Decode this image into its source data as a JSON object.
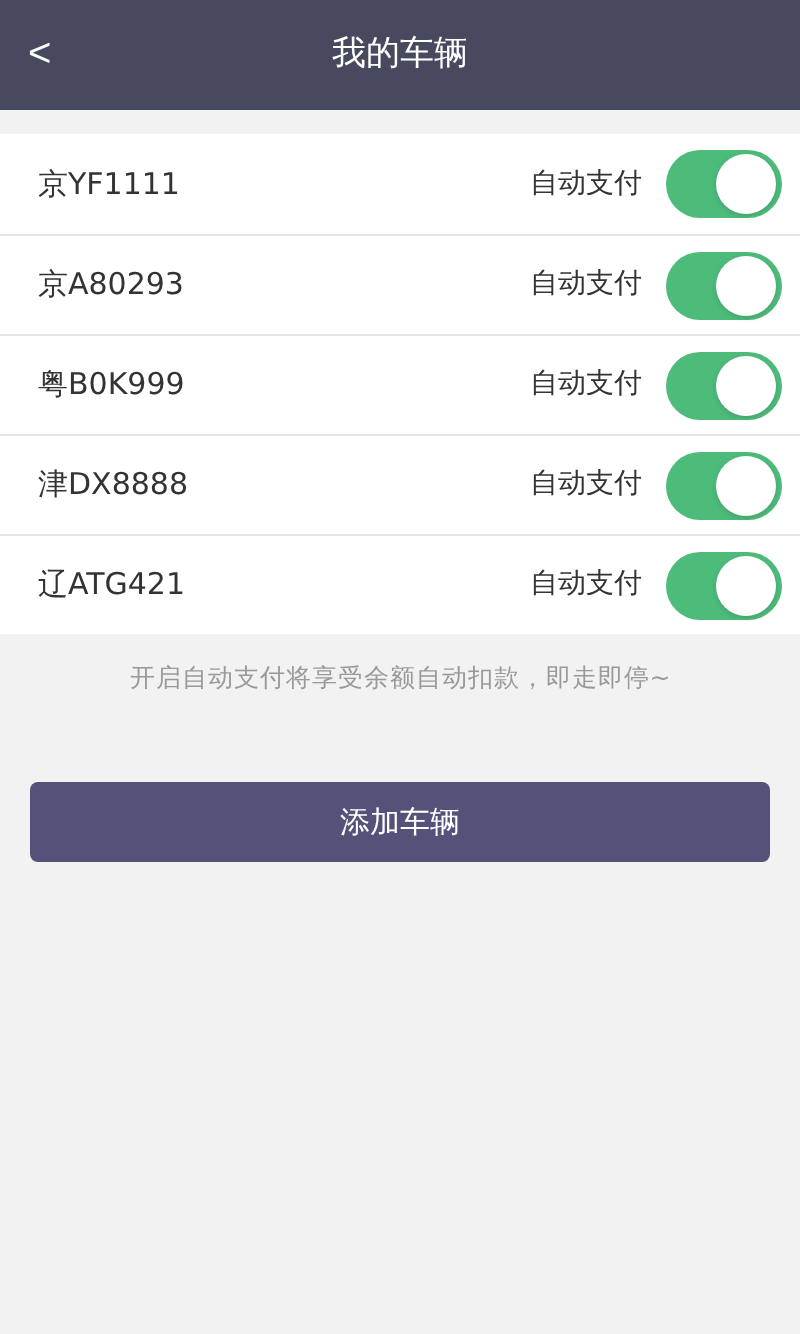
{
  "header": {
    "back_icon": "<",
    "title": "我的车辆"
  },
  "vehicles": [
    {
      "plate": "京YF1111",
      "label": "自动支付",
      "on": true
    },
    {
      "plate": "京A80293",
      "label": "自动支付",
      "on": true
    },
    {
      "plate": "粤B0K999",
      "label": "自动支付",
      "on": true
    },
    {
      "plate": "津DX8888",
      "label": "自动支付",
      "on": true
    },
    {
      "plate": "辽ATG421",
      "label": "自动支付",
      "on": true
    }
  ],
  "note": "开启自动支付将享受余额自动扣款，即走即停~",
  "add_button": "添加车辆"
}
